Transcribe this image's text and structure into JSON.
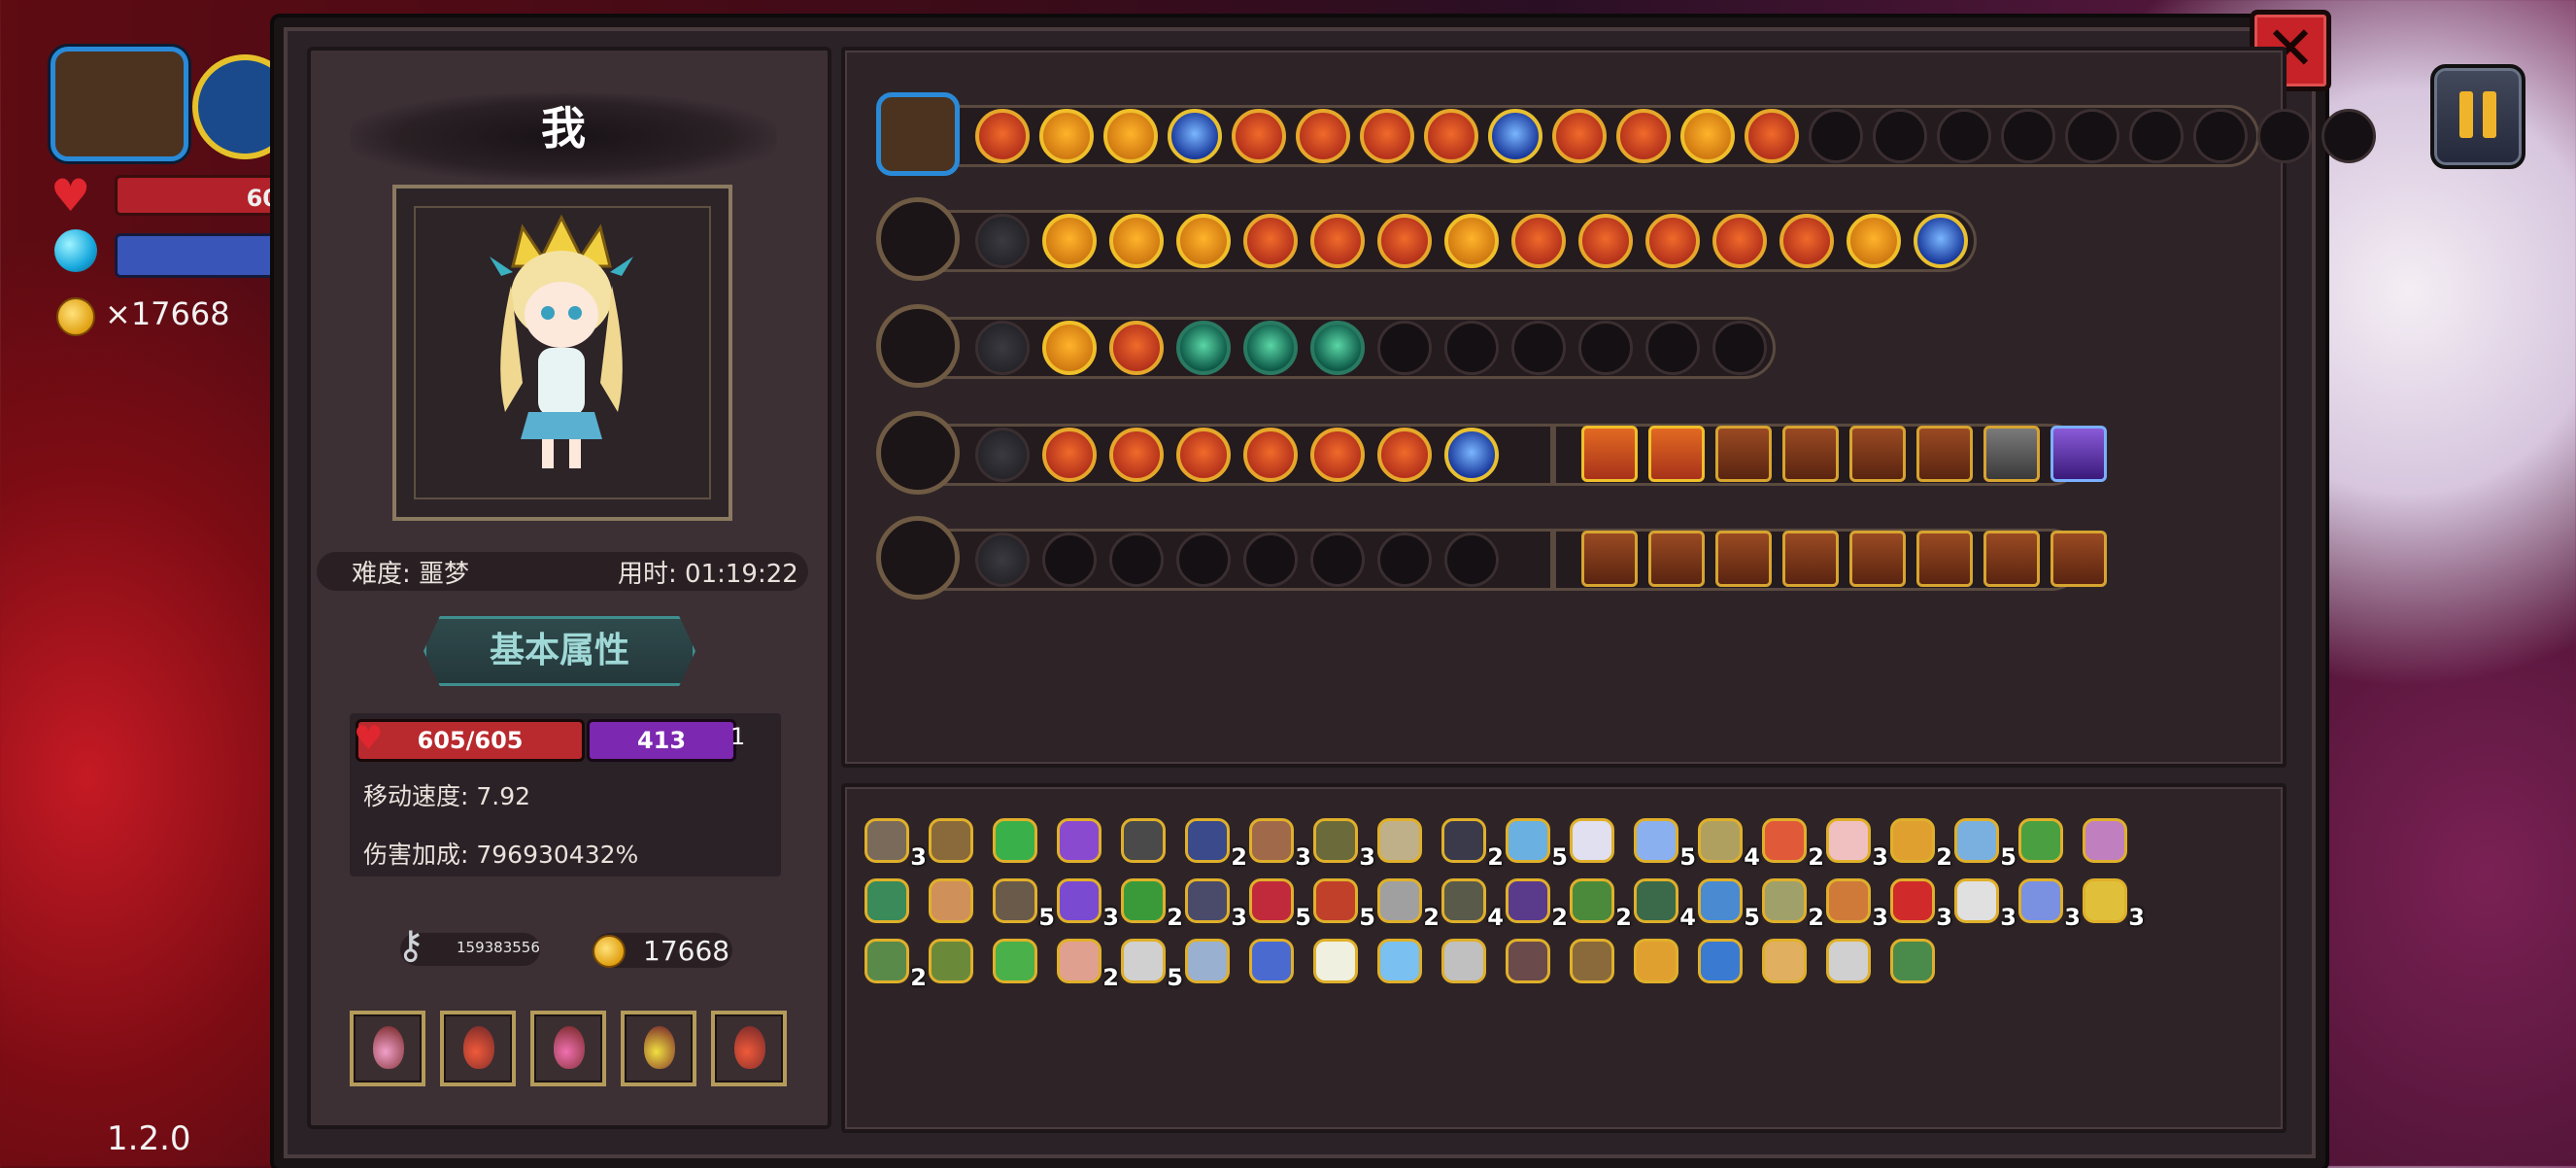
{
  "hud": {
    "hp_text": "60",
    "gold_text": "×17668"
  },
  "version": "1.2.0",
  "close_label": "✕",
  "player": {
    "name": "我",
    "difficulty": "难度: 噩梦",
    "time": "用时: 01:19:22"
  },
  "stats_tab": "基本属性",
  "stats": {
    "hp": "605/605",
    "mp": "413",
    "mp_extra": "1",
    "move_speed": "移动速度: 7.92",
    "damage_bonus": "伤害加成: 796930432%"
  },
  "keys": "159383556",
  "coins": "17668",
  "potions": [
    "#f0a0c8",
    "#f05a3a",
    "#f070b0",
    "#f0e040",
    "#f05a3a"
  ],
  "colors": {
    "accent": "#e5a82a",
    "hp": "#b82a2e",
    "mp": "#7d28b0",
    "close": "#c62227"
  },
  "equipment_rows": [
    {
      "weapon_icon": "chest-icon",
      "slots": [
        "o",
        "g",
        "g",
        "p",
        "o",
        "o",
        "o",
        "o",
        "b",
        "o",
        "o",
        "g",
        "o",
        "e",
        "e",
        "e",
        "e",
        "e",
        "e",
        "e",
        "e",
        "e"
      ]
    },
    {
      "weapon_icon": "green-staff-icon",
      "slots": [
        "l",
        "g",
        "g",
        "g",
        "o",
        "o",
        "o",
        "g",
        "o",
        "o",
        "o",
        "o",
        "o",
        "g",
        "b"
      ]
    },
    {
      "weapon_icon": "ice-blade-icon",
      "slots": [
        "l",
        "g",
        "o",
        "t",
        "t",
        "t",
        "e",
        "e",
        "e",
        "e",
        "e",
        "e"
      ]
    },
    {
      "weapon_icon": "ice-wand-icon",
      "slots": [
        "l",
        "o",
        "o",
        "o",
        "o",
        "o",
        "o",
        "b"
      ],
      "squares": [
        "or",
        "gold",
        "br",
        "br",
        "br",
        "br",
        "gr",
        "pu"
      ]
    },
    {
      "weapon_icon": "crystal-scepter-icon",
      "slots": [
        "l",
        "e",
        "e",
        "e",
        "e",
        "e",
        "e",
        "e"
      ],
      "squares": [
        "br",
        "br",
        "br",
        "br",
        "br",
        "br",
        "br",
        "br"
      ]
    }
  ],
  "items": [
    {
      "c": "#7a6a5a",
      "n": "3"
    },
    {
      "c": "#8a6a3a",
      "n": ""
    },
    {
      "c": "#3ab04a",
      "n": ""
    },
    {
      "c": "#8a4ad0",
      "n": ""
    },
    {
      "c": "#4a4a4a",
      "n": ""
    },
    {
      "c": "#3a4a8a",
      "n": "2"
    },
    {
      "c": "#a06a4a",
      "n": "3"
    },
    {
      "c": "#6a6a3a",
      "n": "3"
    },
    {
      "c": "#c0b08a",
      "n": ""
    },
    {
      "c": "#3a3a4a",
      "n": "2"
    },
    {
      "c": "#6ab0e0",
      "n": "5"
    },
    {
      "c": "#e0e0f0",
      "n": ""
    },
    {
      "c": "#8ab0f0",
      "n": "5"
    },
    {
      "c": "#b0a060",
      "n": "4"
    },
    {
      "c": "#e05a3a",
      "n": "2"
    },
    {
      "c": "#f0c0c0",
      "n": "3"
    },
    {
      "c": "#e0a030",
      "n": "2"
    },
    {
      "c": "#7ab0e0",
      "n": "5"
    },
    {
      "c": "#4aa040",
      "n": ""
    },
    {
      "c": "#c080c0",
      "n": ""
    },
    {
      "c": "#3a8a5a",
      "n": ""
    },
    {
      "c": "#d0905a",
      "n": ""
    },
    {
      "c": "#6a5a4a",
      "n": "5"
    },
    {
      "c": "#7a4ad0",
      "n": "3"
    },
    {
      "c": "#3a9a3a",
      "n": "2"
    },
    {
      "c": "#4a4a6a",
      "n": "3"
    },
    {
      "c": "#c02a3a",
      "n": "5"
    },
    {
      "c": "#c0402a",
      "n": "5"
    },
    {
      "c": "#a0a0a0",
      "n": "2"
    },
    {
      "c": "#5a5a4a",
      "n": "4"
    },
    {
      "c": "#5a3a8a",
      "n": "2"
    },
    {
      "c": "#4a8a3a",
      "n": "2"
    },
    {
      "c": "#3a6a4a",
      "n": "4"
    },
    {
      "c": "#4a8ad0",
      "n": "5"
    },
    {
      "c": "#a0a06a",
      "n": "2"
    },
    {
      "c": "#d07a3a",
      "n": "3"
    },
    {
      "c": "#d02a2a",
      "n": "3"
    },
    {
      "c": "#e0e0e0",
      "n": "3"
    },
    {
      "c": "#7a90e0",
      "n": "3"
    },
    {
      "c": "#e0c03a",
      "n": "3"
    },
    {
      "c": "#5a8a4a",
      "n": "2"
    },
    {
      "c": "#6a8a3a",
      "n": ""
    },
    {
      "c": "#4ab04a",
      "n": ""
    },
    {
      "c": "#e0a090",
      "n": "2"
    },
    {
      "c": "#d0d0d0",
      "n": "5"
    },
    {
      "c": "#9ab0d0",
      "n": ""
    },
    {
      "c": "#4a6ad0",
      "n": ""
    },
    {
      "c": "#f0f0e0",
      "n": ""
    },
    {
      "c": "#7ac0f0",
      "n": ""
    },
    {
      "c": "#c0c0c0",
      "n": ""
    },
    {
      "c": "#6a4a4a",
      "n": ""
    },
    {
      "c": "#8a6a3a",
      "n": ""
    },
    {
      "c": "#e0a030",
      "n": ""
    },
    {
      "c": "#3a7ad0",
      "n": ""
    },
    {
      "c": "#e0b060",
      "n": ""
    },
    {
      "c": "#d0d0d0",
      "n": ""
    },
    {
      "c": "#4a8a4a",
      "n": ""
    }
  ]
}
